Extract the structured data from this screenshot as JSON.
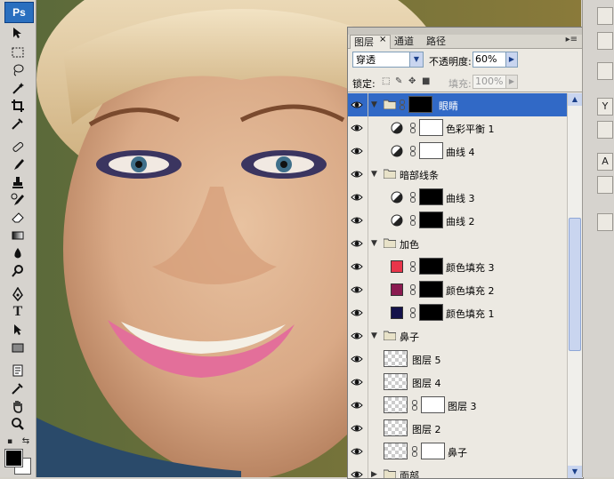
{
  "app": {
    "logo": "Ps"
  },
  "toolbar": {
    "tools": [
      "move-tool",
      "marquee-tool",
      "lasso-tool",
      "magic-wand-tool",
      "crop-tool",
      "eyedropper-tool",
      "healing-brush-tool",
      "brush-tool",
      "clone-stamp-tool",
      "history-brush-tool",
      "eraser-tool",
      "gradient-tool",
      "blur-tool",
      "dodge-tool",
      "pen-tool",
      "type-tool",
      "path-selection-tool",
      "shape-tool",
      "notes-tool",
      "eyedropper2-tool",
      "hand-tool",
      "zoom-tool"
    ],
    "type_glyph": "T",
    "foreground_color": "#000000",
    "background_color": "#ffffff"
  },
  "layers_panel": {
    "tabs": [
      {
        "label": "图层",
        "active": true
      },
      {
        "label": "通道",
        "active": false
      },
      {
        "label": "路径",
        "active": false
      }
    ],
    "blend_mode": "穿透",
    "opacity_label": "不透明度:",
    "opacity_value": "60%",
    "lock_label": "锁定:",
    "fill_label": "填充:",
    "fill_value": "100%",
    "layers": [
      {
        "name": "眼睛",
        "kind": "group",
        "expanded": true,
        "selected": true,
        "thumb": "black",
        "linked": true
      },
      {
        "name": "色彩平衡 1",
        "kind": "adjustment",
        "thumb": "white"
      },
      {
        "name": "曲线 4",
        "kind": "adjustment",
        "thumb": "white"
      },
      {
        "name": "暗部线条",
        "kind": "group",
        "expanded": true
      },
      {
        "name": "曲线 3",
        "kind": "adjustment",
        "thumb": "black"
      },
      {
        "name": "曲线 2",
        "kind": "adjustment",
        "thumb": "black"
      },
      {
        "name": "加色",
        "kind": "group",
        "expanded": true
      },
      {
        "name": "颜色填充 3",
        "kind": "fill",
        "color": "#e8354a",
        "thumb": "black"
      },
      {
        "name": "颜色填充 2",
        "kind": "fill",
        "color": "#8a1a50",
        "thumb": "black"
      },
      {
        "name": "颜色填充 1",
        "kind": "fill",
        "color": "#14124a",
        "thumb": "black"
      },
      {
        "name": "鼻子",
        "kind": "group",
        "expanded": true
      },
      {
        "name": "图层 5",
        "kind": "pixel",
        "thumb": "checker"
      },
      {
        "name": "图层 4",
        "kind": "pixel",
        "thumb": "checker"
      },
      {
        "name": "图层 3",
        "kind": "pixel",
        "thumb": "checker",
        "mask": "white"
      },
      {
        "name": "图层 2",
        "kind": "pixel",
        "thumb": "checker"
      },
      {
        "name": "鼻子",
        "kind": "pixel",
        "thumb": "checker",
        "mask": "white"
      },
      {
        "name": "面部",
        "kind": "group",
        "expanded": false
      }
    ]
  },
  "right_dock": {
    "buttons": [
      "",
      "",
      "Y",
      "",
      "A",
      "",
      ""
    ]
  }
}
